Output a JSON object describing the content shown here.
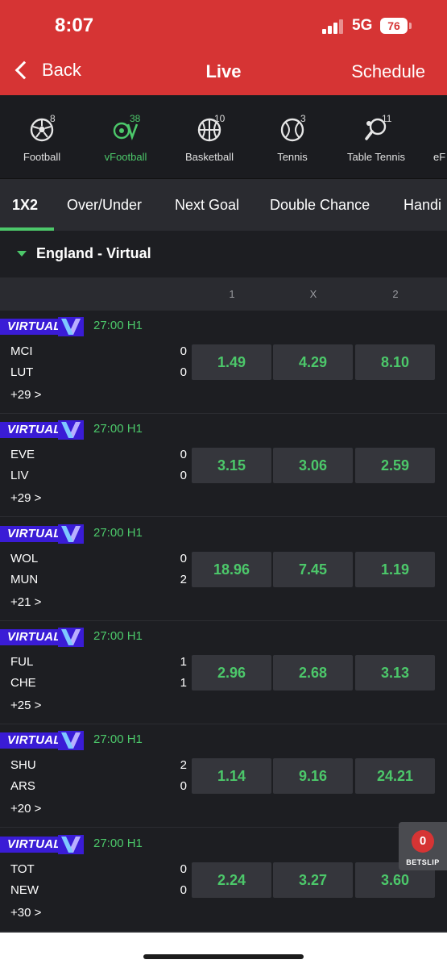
{
  "status": {
    "time": "8:07",
    "network": "5G",
    "battery": "76"
  },
  "header": {
    "back_label": "Back",
    "title": "Live",
    "schedule_label": "Schedule"
  },
  "sports": [
    {
      "label": "Football",
      "count": "8",
      "icon": "soccer-ball-icon",
      "active": false
    },
    {
      "label": "vFootball",
      "count": "38",
      "icon": "virtual-football-icon",
      "active": true
    },
    {
      "label": "Basketball",
      "count": "10",
      "icon": "basketball-icon",
      "active": false
    },
    {
      "label": "Tennis",
      "count": "3",
      "icon": "tennis-ball-icon",
      "active": false
    },
    {
      "label": "Table Tennis",
      "count": "11",
      "icon": "table-tennis-icon",
      "active": false
    },
    {
      "label": "eF",
      "count": "",
      "icon": "",
      "active": false
    }
  ],
  "tabs": [
    "1X2",
    "Over/Under",
    "Next Goal",
    "Double Chance",
    "Handi"
  ],
  "league": {
    "name": "England - Virtual"
  },
  "columns": [
    "1",
    "X",
    "2"
  ],
  "badge_text": "VIRTUAL",
  "matches": [
    {
      "time": "27:00 H1",
      "home": "MCI",
      "away": "LUT",
      "home_score": "0",
      "away_score": "0",
      "more": "+29 >",
      "odds": [
        "1.49",
        "4.29",
        "8.10"
      ]
    },
    {
      "time": "27:00 H1",
      "home": "EVE",
      "away": "LIV",
      "home_score": "0",
      "away_score": "0",
      "more": "+29 >",
      "odds": [
        "3.15",
        "3.06",
        "2.59"
      ]
    },
    {
      "time": "27:00 H1",
      "home": "WOL",
      "away": "MUN",
      "home_score": "0",
      "away_score": "2",
      "more": "+21 >",
      "odds": [
        "18.96",
        "7.45",
        "1.19"
      ]
    },
    {
      "time": "27:00 H1",
      "home": "FUL",
      "away": "CHE",
      "home_score": "1",
      "away_score": "1",
      "more": "+25 >",
      "odds": [
        "2.96",
        "2.68",
        "3.13"
      ]
    },
    {
      "time": "27:00 H1",
      "home": "SHU",
      "away": "ARS",
      "home_score": "2",
      "away_score": "0",
      "more": "+20 >",
      "odds": [
        "1.14",
        "9.16",
        "24.21"
      ]
    },
    {
      "time": "27:00 H1",
      "home": "TOT",
      "away": "NEW",
      "home_score": "0",
      "away_score": "0",
      "more": "+30 >",
      "odds": [
        "2.24",
        "3.27",
        "3.60"
      ]
    }
  ],
  "betslip": {
    "count": "0",
    "label": "BETSLIP"
  },
  "colors": {
    "header_red": "#d63434",
    "accent_green": "#4cc86a",
    "virtual_purple": "#3a1cd6",
    "background": "#1d1e22"
  }
}
